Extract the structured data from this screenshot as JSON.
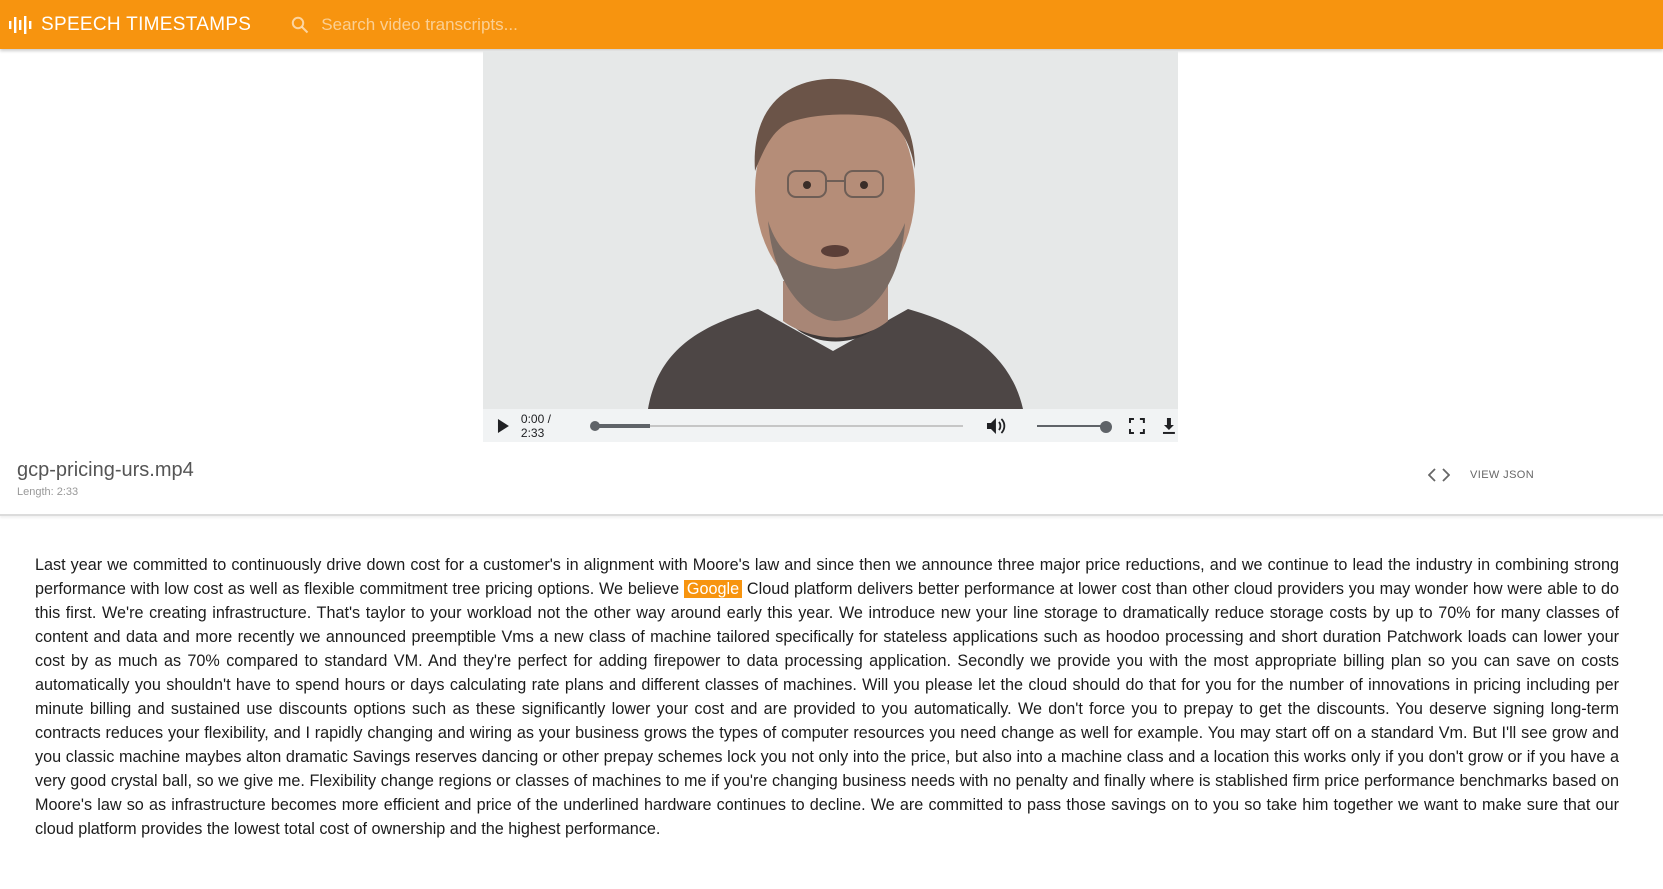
{
  "header": {
    "app_title": "SPEECH TIMESTAMPS",
    "search_placeholder": "Search video transcripts...",
    "icons": {
      "logo": "audio-waveform-icon",
      "search": "search-icon"
    },
    "accent_color": "#f7940f"
  },
  "player": {
    "time_display": "0:00 / 2:33",
    "progress_fraction": 0.15,
    "volume_fraction": 1.0,
    "icons": {
      "play": "play-icon",
      "volume": "volume-icon",
      "fullscreen": "fullscreen-icon",
      "download": "download-icon"
    }
  },
  "file": {
    "name": "gcp-pricing-urs.mp4",
    "length": "Length: 2:33",
    "view_json_label": "VIEW JSON",
    "icons": {
      "code": "code-icon"
    }
  },
  "transcript": {
    "before": "Last year we committed to continuously drive down cost for a customer's in alignment with Moore's law and since then we announce three major price reductions, and we continue to lead the industry in combining strong performance with low cost as well as flexible commitment tree pricing options. We believe ",
    "highlighted_word": "Google",
    "after": " Cloud platform delivers better performance at lower cost than other cloud providers you may wonder how were able to do this first. We're creating infrastructure. That's taylor to your workload not the other way around early this year. We introduce new your line storage to dramatically reduce storage costs by up to 70% for many classes of content and data and more recently we announced preemptible Vms a new class of machine tailored specifically for stateless applications such as hoodoo processing and short duration Patchwork loads can lower your cost by as much as 70% compared to standard VM. And they're perfect for adding firepower to data processing application. Secondly we provide you with the most appropriate billing plan so you can save on costs automatically you shouldn't have to spend hours or days calculating rate plans and different classes of machines. Will you please let the cloud should do that for you for the number of innovations in pricing including per minute billing and sustained use discounts options such as these significantly lower your cost and are provided to you automatically. We don't force you to prepay to get the discounts. You deserve signing long-term contracts reduces your flexibility, and I rapidly changing and wiring as your business grows the types of computer resources you need change as well for example. You may start off on a standard Vm. But I'll see grow and you classic machine maybes alton dramatic Savings reserves dancing or other prepay schemes lock you not only into the price, but also into a machine class and a location this works only if you don't grow or if you have a very good crystal ball, so we give me. Flexibility change regions or classes of machines to me if you're changing business needs with no penalty and finally where is stablished firm price performance benchmarks based on Moore's law so as infrastructure becomes more efficient and price of the underlined hardware continues to decline. We are committed to pass those savings on to you so take him together we want to make sure that our cloud platform provides the lowest total cost of ownership and the highest performance."
  }
}
